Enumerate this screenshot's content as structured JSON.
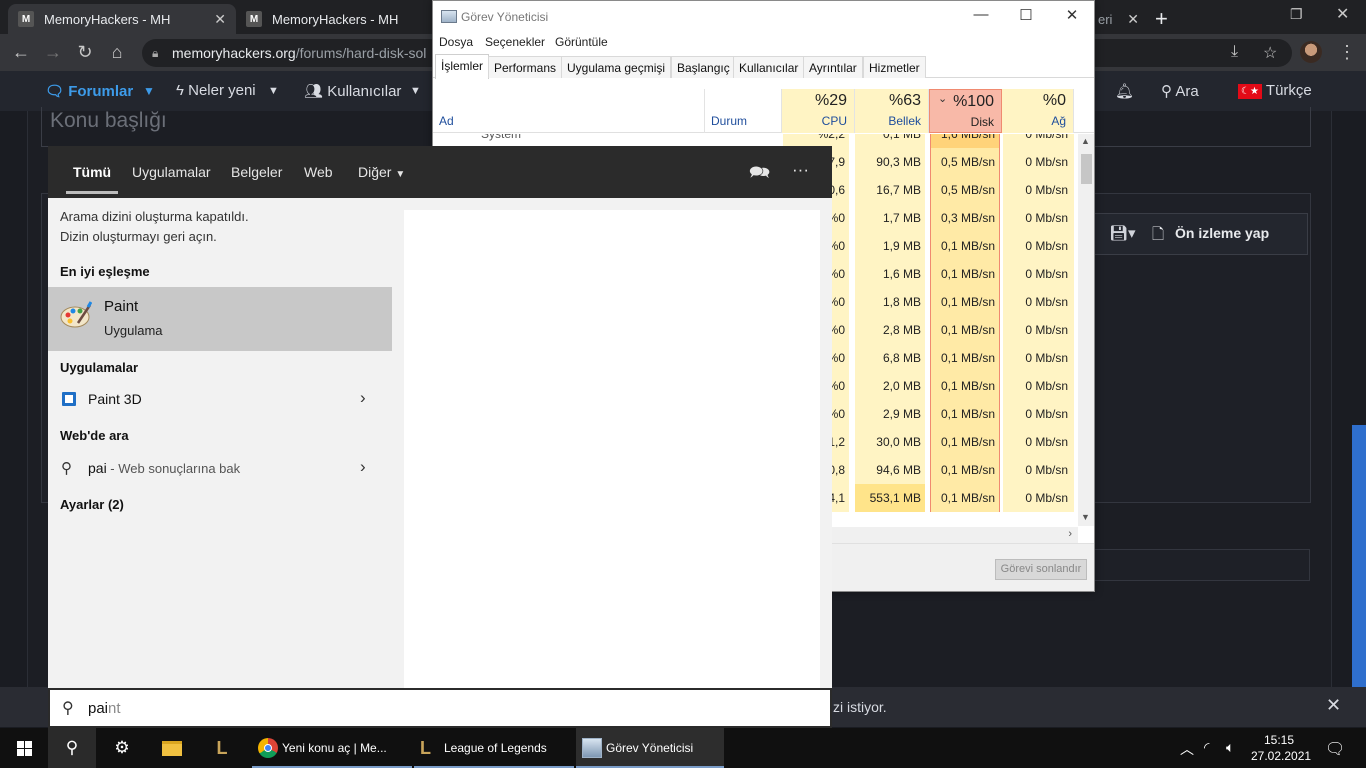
{
  "browser": {
    "tabs": [
      {
        "title": "MemoryHackers - MH",
        "fav": "M"
      },
      {
        "title": "MemoryHackers - MH",
        "fav": "M"
      },
      {
        "title": "eri",
        "fav": ""
      }
    ],
    "url_host": "memoryhackers.org",
    "url_path": "/forums/hard-disk-sol"
  },
  "site": {
    "nav": {
      "forums": "Forumlar",
      "whats_new": "Neler yeni",
      "members": "Kullanıcılar",
      "search": "Ara",
      "language": "Türkçe"
    },
    "topic_title_placeholder": "Konu başlığı",
    "preview_button": "Ön izleme yap",
    "notification_text": "zi istiyor."
  },
  "task_manager": {
    "title": "Görev Yöneticisi",
    "menu": [
      "Dosya",
      "Seçenekler",
      "Görüntüle"
    ],
    "tabs": [
      "İşlemler",
      "Performans",
      "Uygulama geçmişi",
      "Başlangıç",
      "Kullanıcılar",
      "Ayrıntılar",
      "Hizmetler"
    ],
    "columns": {
      "name": "Ad",
      "status": "Durum",
      "cpu": {
        "pct": "%29",
        "label": "CPU"
      },
      "memory": {
        "pct": "%63",
        "label": "Bellek"
      },
      "disk": {
        "pct": "%100",
        "label": "Disk"
      },
      "network": {
        "pct": "%0",
        "label": "Ağ"
      }
    },
    "rows": [
      {
        "name": "System",
        "cpu": "%2,2",
        "mem": "0,1 MB",
        "disk": "1,6 MB/sn",
        "net": "0 Mb/sn"
      },
      {
        "name": "",
        "cpu": "7,9",
        "mem": "90,3 MB",
        "disk": "0,5 MB/sn",
        "net": "0 Mb/sn"
      },
      {
        "name": "",
        "cpu": "0,6",
        "mem": "16,7 MB",
        "disk": "0,5 MB/sn",
        "net": "0 Mb/sn"
      },
      {
        "name": "",
        "cpu": "%0",
        "mem": "1,7 MB",
        "disk": "0,3 MB/sn",
        "net": "0 Mb/sn"
      },
      {
        "name": "",
        "cpu": "%0",
        "mem": "1,9 MB",
        "disk": "0,1 MB/sn",
        "net": "0 Mb/sn"
      },
      {
        "name": "",
        "cpu": "%0",
        "mem": "1,6 MB",
        "disk": "0,1 MB/sn",
        "net": "0 Mb/sn"
      },
      {
        "name": "",
        "cpu": "%0",
        "mem": "1,8 MB",
        "disk": "0,1 MB/sn",
        "net": "0 Mb/sn"
      },
      {
        "name": "",
        "cpu": "%0",
        "mem": "2,8 MB",
        "disk": "0,1 MB/sn",
        "net": "0 Mb/sn"
      },
      {
        "name": "",
        "cpu": "%0",
        "mem": "6,8 MB",
        "disk": "0,1 MB/sn",
        "net": "0 Mb/sn"
      },
      {
        "name": "",
        "cpu": "%0",
        "mem": "2,0 MB",
        "disk": "0,1 MB/sn",
        "net": "0 Mb/sn"
      },
      {
        "name": "",
        "cpu": "%0",
        "mem": "2,9 MB",
        "disk": "0,1 MB/sn",
        "net": "0 Mb/sn"
      },
      {
        "name": "",
        "cpu": "1,2",
        "mem": "30,0 MB",
        "disk": "0,1 MB/sn",
        "net": "0 Mb/sn"
      },
      {
        "name": "",
        "cpu": "0,8",
        "mem": "94,6 MB",
        "disk": "0,1 MB/sn",
        "net": "0 Mb/sn"
      },
      {
        "name": "",
        "cpu": "4,1",
        "mem": "553,1 MB",
        "disk": "0,1 MB/sn",
        "net": "0 Mb/sn"
      }
    ],
    "end_task": "Görevi sonlandır"
  },
  "search_panel": {
    "tabs": [
      "Tümü",
      "Uygulamalar",
      "Belgeler",
      "Web",
      "Diğer"
    ],
    "info_line1": "Arama dizini oluşturma kapatıldı.",
    "info_line2": "Dizin oluşturmayı geri açın.",
    "best_match_header": "En iyi eşleşme",
    "best_match": {
      "name_bold": "Pai",
      "name_rest": "nt",
      "type": "Uygulama"
    },
    "apps_header": "Uygulamalar",
    "app_item": {
      "bold": "Pai",
      "rest": "nt 3D"
    },
    "web_header": "Web'de ara",
    "web_item": {
      "query": "pai",
      "suffix": " - Web sonuçlarına bak"
    },
    "settings_header": "Ayarlar (2)",
    "query_typed": "pai",
    "query_ghost": "nt"
  },
  "taskbar": {
    "apps": [
      {
        "label": "Yeni konu aç | Me..."
      },
      {
        "label": "League of Legends"
      },
      {
        "label": "Görev Yöneticisi"
      }
    ],
    "time": "15:15",
    "date": "27.02.2021"
  }
}
